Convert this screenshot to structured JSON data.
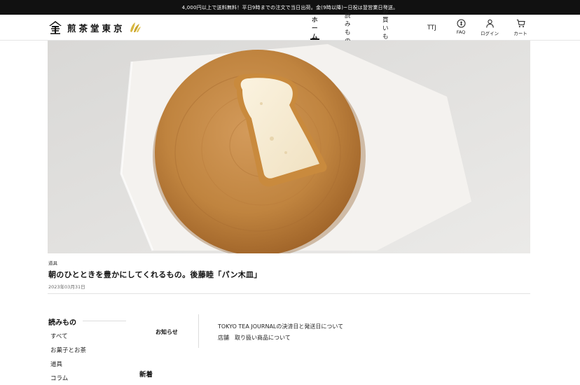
{
  "announcement": "4,000円以上で送料無料！平日9時までの注文で当日出荷。金(9時以降)~日祝は翌営業日発送。",
  "brand": {
    "name": "煎茶堂東京"
  },
  "nav": {
    "items": [
      {
        "label": "ホーム",
        "active": true
      },
      {
        "label": "読みもの",
        "active": false
      },
      {
        "label": "お買いもの",
        "active": false
      },
      {
        "label": "TTJ",
        "active": false
      }
    ],
    "icons": [
      {
        "icon": "faq-icon",
        "label": "FAQ"
      },
      {
        "icon": "user-icon",
        "label": "ログイン"
      },
      {
        "icon": "cart-icon",
        "label": "カート"
      }
    ]
  },
  "article": {
    "category": "道具",
    "title": "朝のひとときを豊かにしてくれるもの。後藤睦「パン木皿」",
    "date": "2023年03月31日"
  },
  "sidebar": {
    "title": "読みもの",
    "items": [
      "すべて",
      "お菓子とお茶",
      "道具",
      "コラム"
    ]
  },
  "news": {
    "label": "お知らせ",
    "items": [
      "TOKYO TEA JOURNALの決済日と発送日について",
      "店舗　取り扱い商品について"
    ]
  },
  "new_section": {
    "label": "新着"
  },
  "colors": {
    "announce_bg": "#111111",
    "text": "#222222",
    "wood": "#c28a4e"
  }
}
